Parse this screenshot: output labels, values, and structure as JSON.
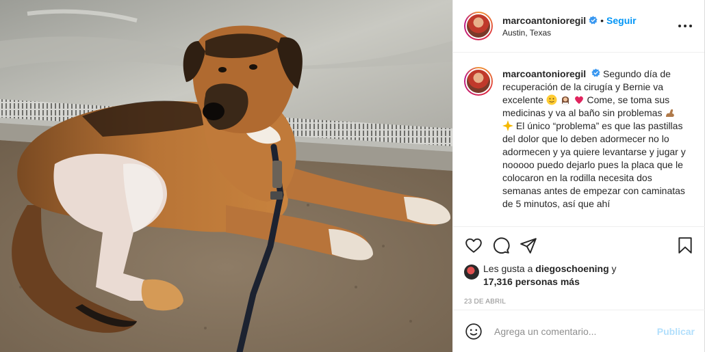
{
  "post": {
    "photo_alt": "Bernie",
    "username": "marcoantonioregil",
    "location": "Austin, Texas",
    "follow_label": "Seguir",
    "separator": "•",
    "caption": {
      "username": "marcoantonioregil",
      "part1": "Segundo día de recuperación de la cirugía y Bernie va excelente",
      "part2": "Come, se toma sus medicinas y va al baño sin problemas",
      "part3": "El único “problema” es que las pastillas del dolor que lo deben adormecer no lo adormecen y ya quiere levantarse y jugar y nooooo puedo dejarlo pues la placa que le colocaron en la rodilla necesita dos semanas antes de empezar con caminatas de 5 minutos, así que ahí"
    },
    "likes": {
      "prefix": "Les gusta a",
      "user": "diegoschoening",
      "conj": "y",
      "count": "17,316 personas más"
    },
    "date": "23 DE ABRIL",
    "comment_placeholder": "Agrega un comentario...",
    "publish_label": "Publicar"
  },
  "colors": {
    "link_blue": "#0095f6",
    "publish_disabled": "#b2dffc",
    "muted": "#8e8e8e",
    "text": "#262626"
  },
  "icons": [
    "more-options-icon",
    "verified-badge-icon",
    "heart-icon",
    "comment-icon",
    "share-icon",
    "bookmark-icon",
    "emoji-icon"
  ]
}
